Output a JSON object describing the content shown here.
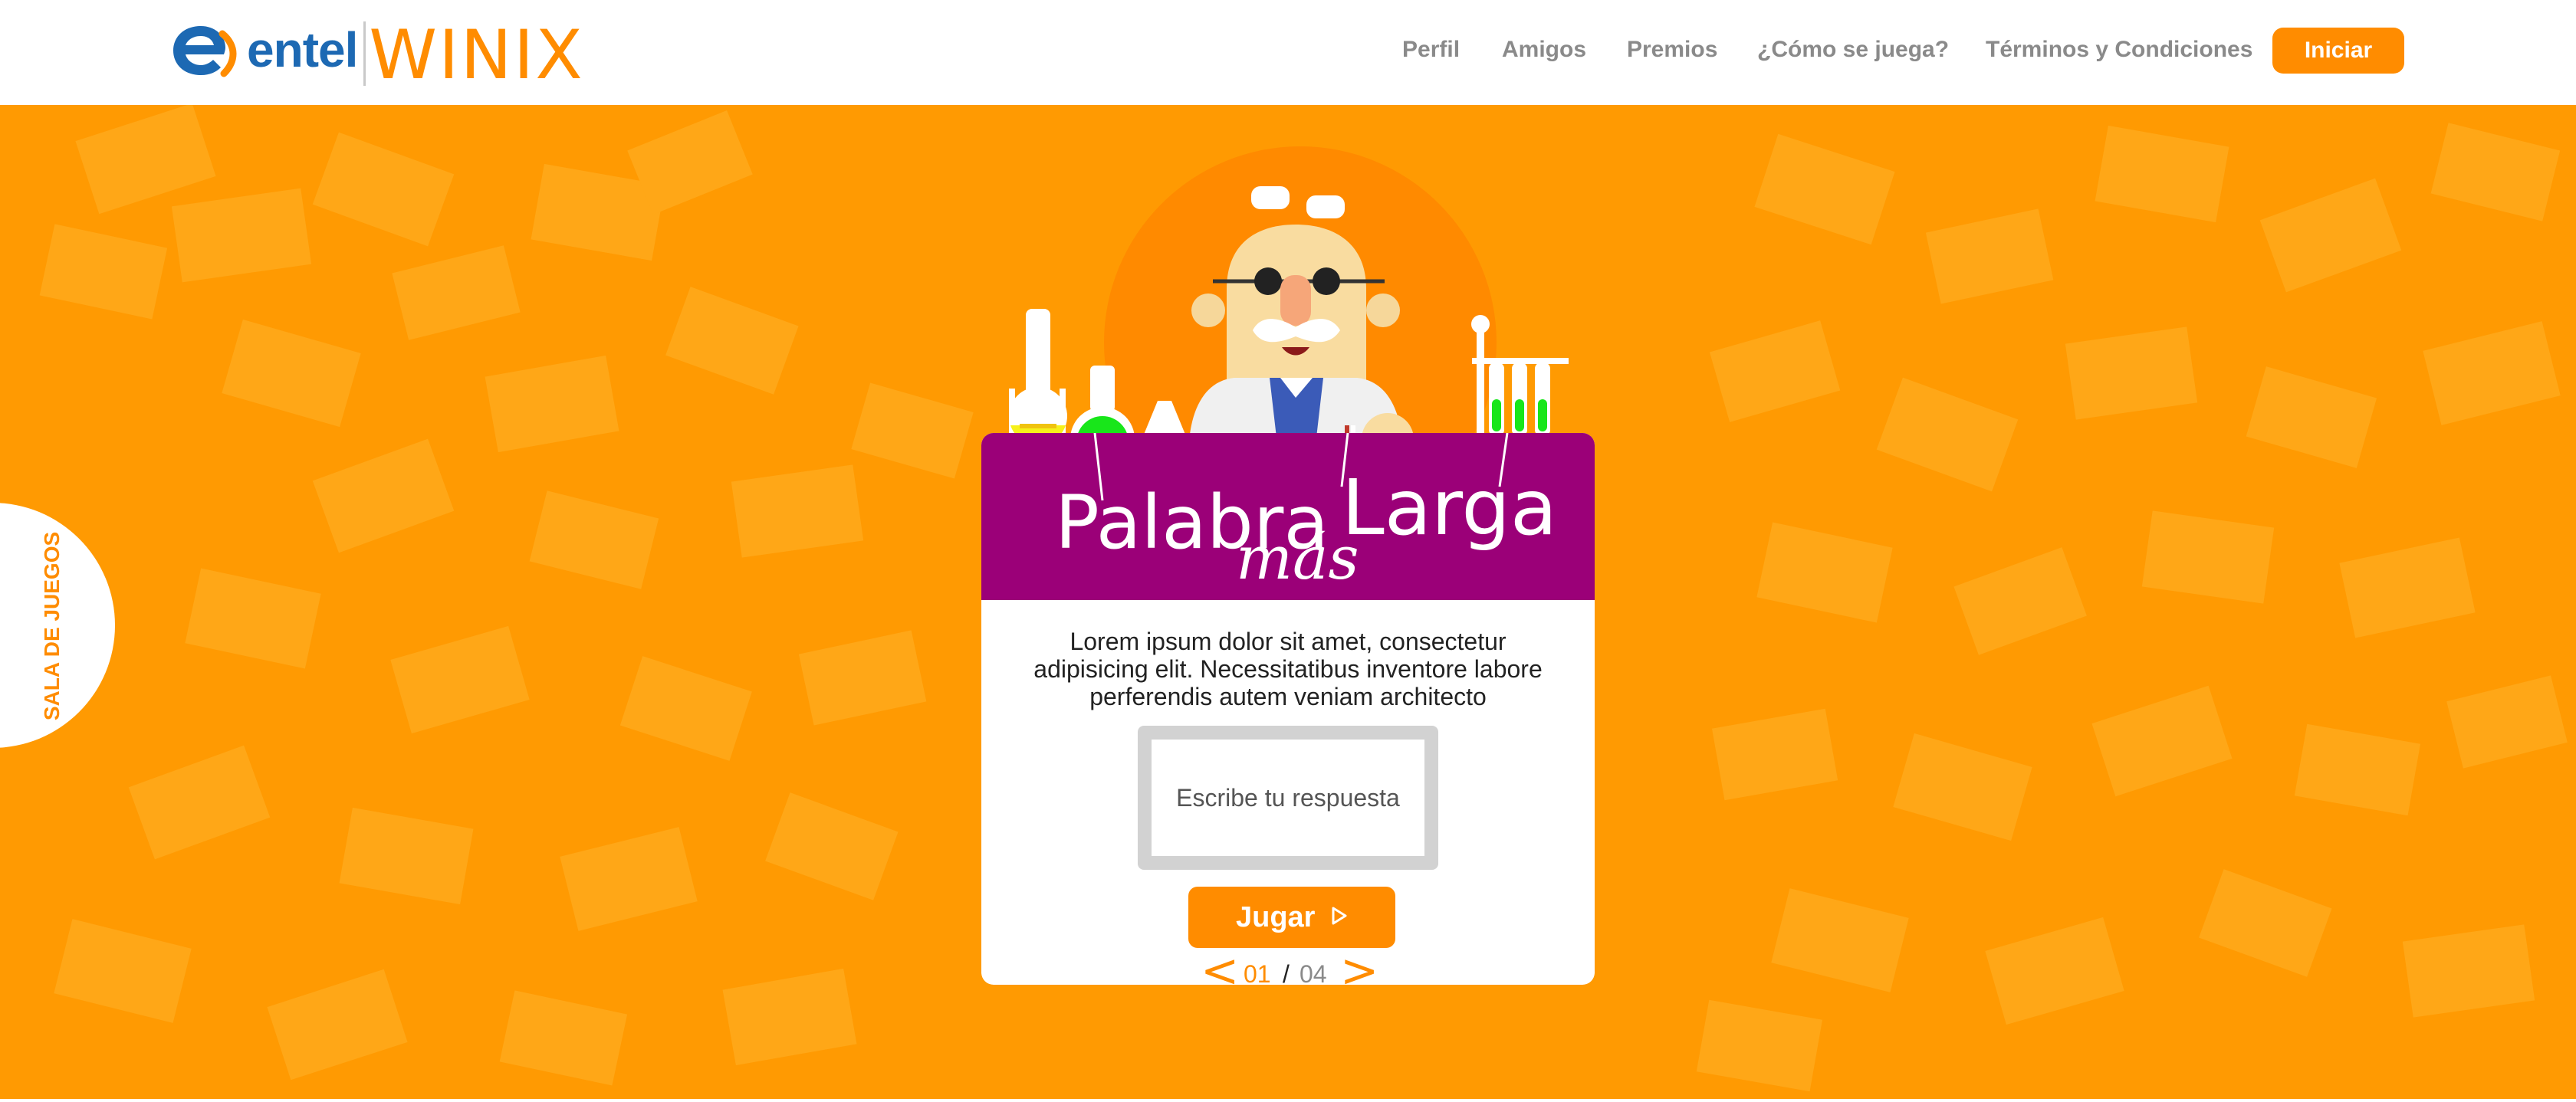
{
  "brand": {
    "entel": "entel",
    "winix": "WINIX",
    "primary_color": "#ff8c00",
    "entel_blue": "#1d69b3"
  },
  "nav": {
    "items": [
      {
        "label": "Perfil"
      },
      {
        "label": "Amigos"
      },
      {
        "label": "Premios"
      },
      {
        "label": "¿Cómo se juega?"
      },
      {
        "label": "Términos y Condiciones"
      }
    ],
    "cta_label": "Iniciar"
  },
  "side_tab": {
    "label": "SALA DE JUEGOS"
  },
  "game": {
    "title_word_1": "Palabra",
    "title_word_2": "más",
    "title_word_3": "Larga",
    "banner_color": "#9b0078",
    "description": "Lorem ipsum dolor sit amet, consectetur adipisicing elit. Necessitatibus inventore labore perferendis autem veniam architecto",
    "answer_placeholder": "Escribe tu respuesta",
    "play_label": "Jugar",
    "pager": {
      "current": "01",
      "separator": "/",
      "total": "04",
      "prev_icon": "chevron-left-icon",
      "next_icon": "chevron-right-icon"
    }
  },
  "background_color": "#ff9a02"
}
